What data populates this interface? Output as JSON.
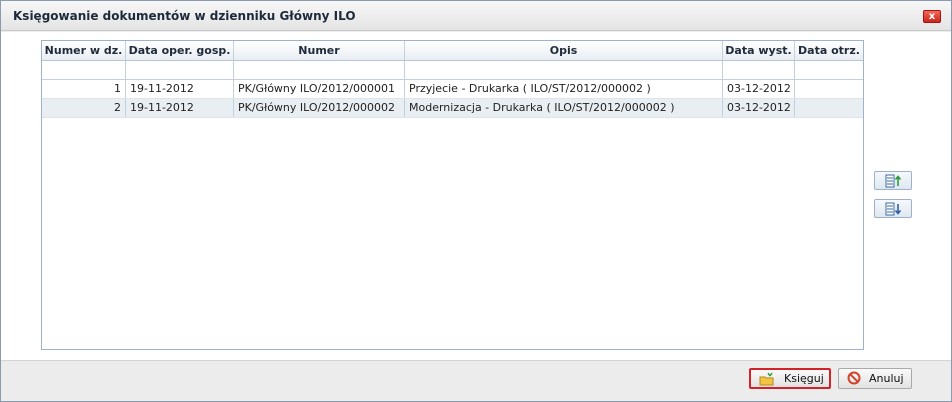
{
  "dialog": {
    "title": "Księgowanie dokumentów w dzienniku Główny ILO",
    "close_label": "x"
  },
  "grid": {
    "columns": [
      "Numer w dz.",
      "Data oper. gosp.",
      "Numer",
      "Opis",
      "Data wyst.",
      "Data otrz."
    ],
    "rows": [
      [
        "1",
        "19-11-2012",
        "PK/Główny ILO/2012/000001",
        "Przyjecie - Drukarka ( ILO/ST/2012/000002 )",
        "03-12-2012",
        ""
      ],
      [
        "2",
        "19-11-2012",
        "PK/Główny ILO/2012/000002",
        "Modernizacja - Drukarka ( ILO/ST/2012/000002 )",
        "03-12-2012",
        ""
      ]
    ]
  },
  "side": {
    "move_up_icon": "move-up-icon",
    "move_down_icon": "move-down-icon"
  },
  "footer": {
    "book_label": "Księguj",
    "cancel_label": "Anuluj"
  },
  "colors": {
    "accent_border": "#d2232a",
    "header_gradient_end": "#e9eef4",
    "alt_row": "#e9eef3"
  }
}
